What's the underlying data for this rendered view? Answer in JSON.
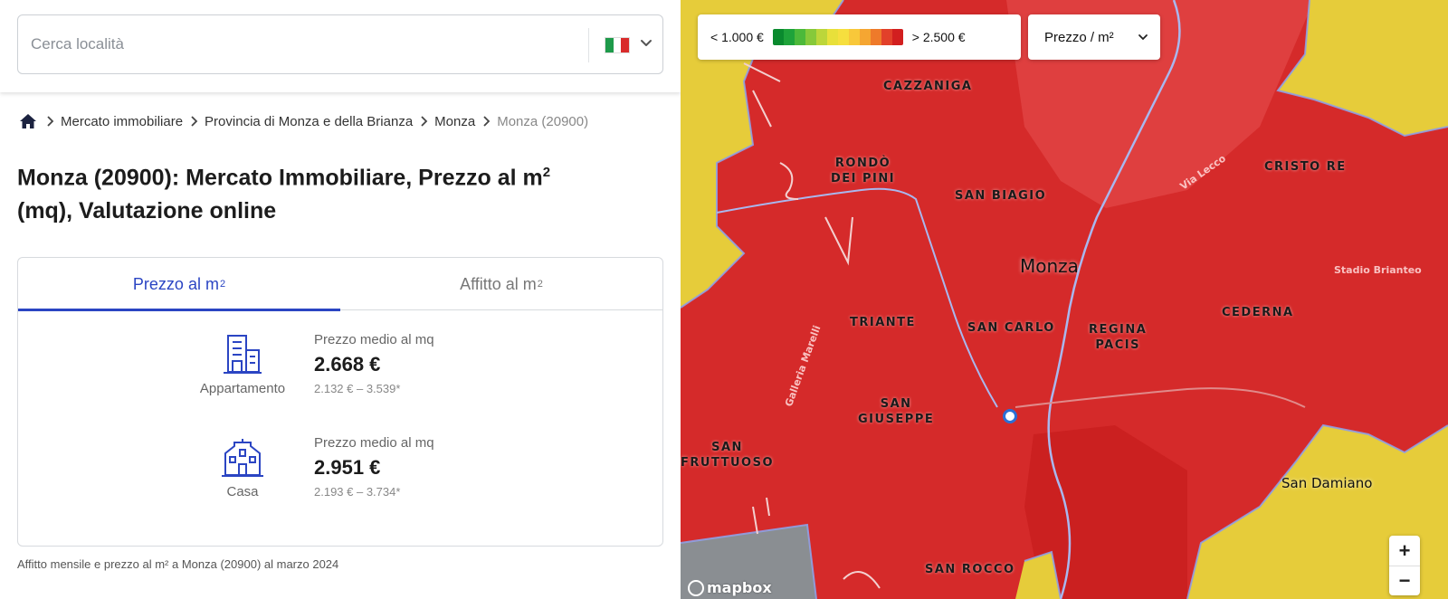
{
  "search": {
    "placeholder": "Cerca località",
    "country_flag": "italy-flag-icon"
  },
  "breadcrumb": {
    "items": [
      "Mercato immobiliare",
      "Provincia di Monza e della Brianza",
      "Monza",
      "Monza (20900)"
    ]
  },
  "page": {
    "title_part1": "Monza (20900): Mercato Immobiliare, Prezzo al m",
    "title_sup": "2",
    "title_part2": "(mq), Valutazione online"
  },
  "tabs": [
    {
      "label": "Prezzo al m",
      "sup": "2",
      "active": true
    },
    {
      "label": "Affitto al m",
      "sup": "2",
      "active": false
    }
  ],
  "prices": [
    {
      "type": "Appartamento",
      "icon": "apartment-building-icon",
      "label": "Prezzo medio al mq",
      "price": "2.668 €",
      "range": "2.132 € – 3.539*"
    },
    {
      "type": "Casa",
      "icon": "house-icon",
      "label": "Prezzo medio al mq",
      "price": "2.951 €",
      "range": "2.193 € – 3.734*"
    }
  ],
  "footnote": "Affitto mensile e prezzo al m² a Monza (20900) al marzo 2024",
  "map": {
    "legend": {
      "min_label": "< 1.000 €",
      "max_label": "> 2.500 €",
      "colors": [
        "#0a8a2e",
        "#1ea33a",
        "#4cb93a",
        "#86c93a",
        "#bcd63a",
        "#e8e03a",
        "#f6df3e",
        "#f8c83a",
        "#f5a632",
        "#ee7a2a",
        "#e2402a",
        "#d21f1f"
      ]
    },
    "metric_select": "Prezzo / m²",
    "city_label": "Monza",
    "neighborhoods": [
      {
        "name": "CAZZANIGA"
      },
      {
        "name": "RONDÒ\nDEI PINI"
      },
      {
        "name": "SAN BIAGIO"
      },
      {
        "name": "CRISTO RE"
      },
      {
        "name": "TRIANTE"
      },
      {
        "name": "SAN CARLO"
      },
      {
        "name": "REGINA\nPACIS"
      },
      {
        "name": "CEDERNA"
      },
      {
        "name": "SAN\nGIUSEPPE"
      },
      {
        "name": "SAN\nFRUTTUOSO"
      },
      {
        "name": "SAN ROCCO"
      }
    ],
    "places": [
      "San Damiano",
      "Stadio Brianteo"
    ],
    "roads": [
      "Via Lecco",
      "Galleria Marelli"
    ],
    "zoom_in": "+",
    "zoom_out": "−",
    "attribution": "mapbox"
  }
}
